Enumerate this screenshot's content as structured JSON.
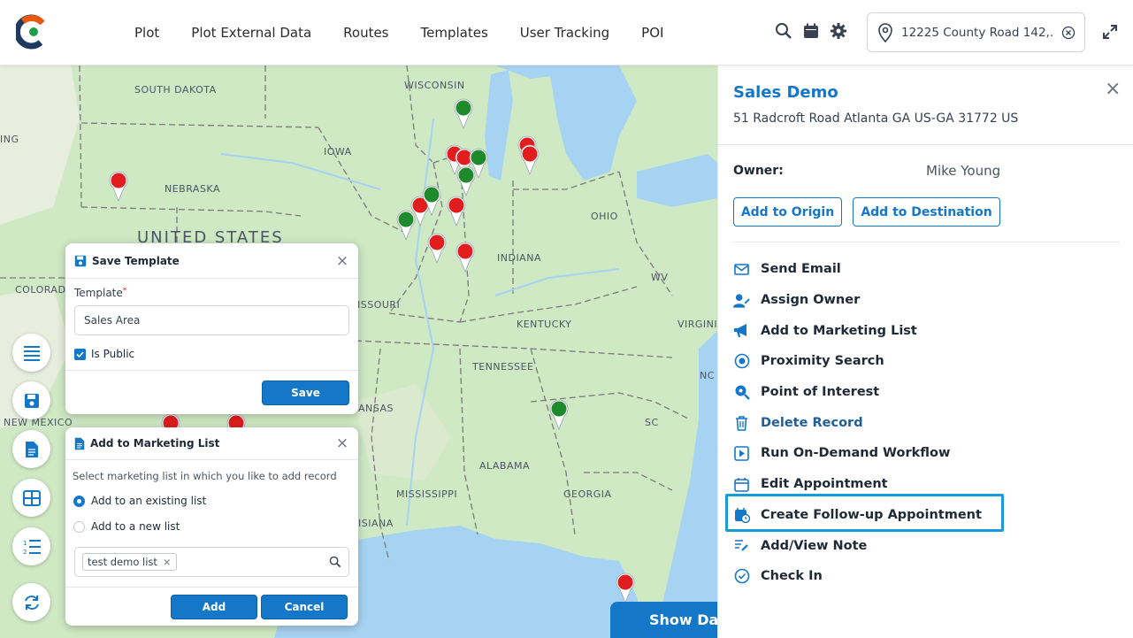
{
  "header": {
    "nav": [
      "Plot",
      "Plot External Data",
      "Routes",
      "Templates",
      "User Tracking",
      "POI"
    ],
    "location_value": "12225 County Road 142,..."
  },
  "map": {
    "states": [
      "SOUTH DAKOTA",
      "WISCONSIN",
      "IOWA",
      "NEBRASKA",
      "OHIO",
      "INDIANA",
      "COLORADO",
      "ISSOURI",
      "KENTUCKY",
      "WV",
      "VIRGINI",
      "TENNESSEE",
      "NC",
      "ANSAS",
      "NEW MEXICO",
      "SC",
      "ALABAMA",
      "MISSISSIPPI",
      "GEORGIA",
      "ISIANA",
      "ING"
    ],
    "country": "UNITED STATES",
    "show_button": "Show Da"
  },
  "save_template": {
    "title": "Save Template",
    "field_label": "Template",
    "field_value": "Sales Area",
    "checkbox_label": "Is Public",
    "checkbox_checked": true,
    "save_label": "Save"
  },
  "marketing": {
    "title": "Add to Marketing List",
    "prompt": "Select marketing list in which you like to add record",
    "option_existing": "Add to an existing list",
    "option_new": "Add to a new list",
    "tag": "test demo list",
    "add_label": "Add",
    "cancel_label": "Cancel"
  },
  "panel": {
    "title": "Sales Demo",
    "address": "51 Radcroft Road Atlanta GA US-GA 31772 US",
    "owner_label": "Owner:",
    "owner_value": "Mike Young",
    "add_origin": "Add to Origin",
    "add_destination": "Add to Destination",
    "actions": [
      {
        "label": "Send Email",
        "icon": "mail-icon"
      },
      {
        "label": "Assign Owner",
        "icon": "assign-user-icon"
      },
      {
        "label": "Add to Marketing List",
        "icon": "megaphone-icon"
      },
      {
        "label": "Proximity Search",
        "icon": "target-icon"
      },
      {
        "label": "Point of Interest",
        "icon": "search-pin-icon"
      },
      {
        "label": "Delete Record",
        "icon": "trash-icon"
      },
      {
        "label": "Run On-Demand Workflow",
        "icon": "play-icon"
      },
      {
        "label": "Edit Appointment",
        "icon": "calendar-edit-icon"
      },
      {
        "label": "Create Follow-up Appointment",
        "icon": "calendar-clock-icon"
      },
      {
        "label": "Add/View Note",
        "icon": "note-icon"
      },
      {
        "label": "Check In",
        "icon": "check-circle-icon"
      }
    ]
  },
  "colors": {
    "accent": "#1577c7",
    "highlight": "#1a9ad6",
    "pin_red": "#e11d1d",
    "pin_green": "#1f8a2b"
  }
}
